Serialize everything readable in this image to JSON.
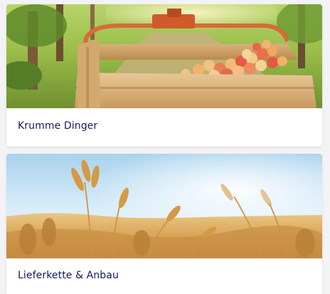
{
  "cards": [
    {
      "label": "Krumme Dinger",
      "image": "apple-crate-photo"
    },
    {
      "label": "Lieferkette & Anbau",
      "image": "wheat-field-photo"
    }
  ],
  "colors": {
    "label_text": "#13195a",
    "card_background": "#ffffff",
    "page_background": "#f3f3f5"
  }
}
